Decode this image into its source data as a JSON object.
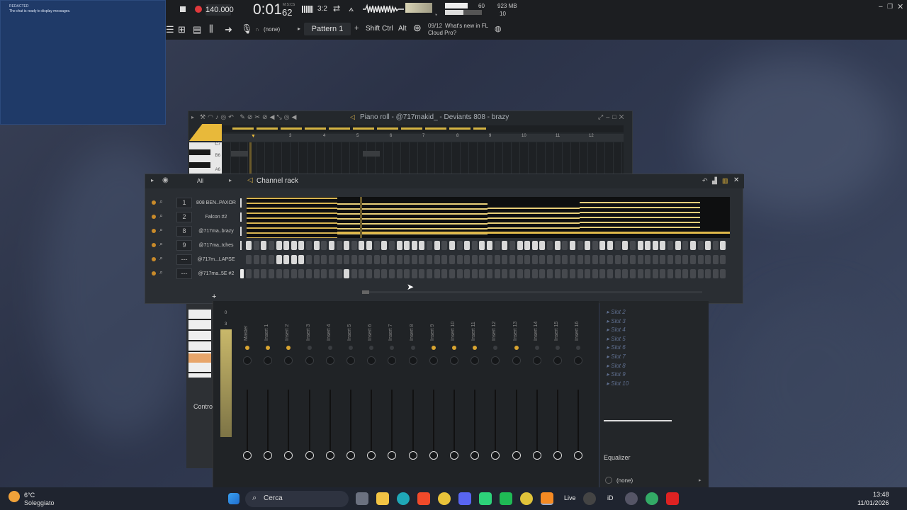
{
  "chat": {
    "title": "REDACTED",
    "message": "The chat is ready to display messages."
  },
  "toolbar": {
    "tempo": "140.000",
    "time": "0:01",
    "time_small": "62",
    "time_mode": "M:S:CS",
    "time_sig": "3:2",
    "cpu": "60",
    "memory": "923 MB",
    "voices": "10",
    "pattern": "Pattern 1",
    "mic_input": "(none)",
    "shift": "Shift",
    "ctrl": "Ctrl",
    "alt": "Alt",
    "news_date": "09/12",
    "news_text": "What's new in FL",
    "news_text2": "Cloud Pro?"
  },
  "piano_roll": {
    "title": "Piano roll - @717makid_ - Deviants 808 - brazy",
    "bars": [
      "3",
      "4",
      "5",
      "6",
      "7",
      "8",
      "9",
      "10",
      "11",
      "12"
    ],
    "key_labels": [
      "C7",
      "B6",
      "A6"
    ]
  },
  "channel_rack": {
    "title": "Channel rack",
    "filter": "All",
    "channels": [
      {
        "num": "1",
        "name": "808 BEN..PAXOR"
      },
      {
        "num": "2",
        "name": "Falcon #2"
      },
      {
        "num": "8",
        "name": "@717ma..brazy"
      },
      {
        "num": "9",
        "name": "@717ma..tches"
      },
      {
        "num": "---",
        "name": "@717m...LAPSE"
      },
      {
        "num": "---",
        "name": "@717ma..5E #2"
      }
    ]
  },
  "mixer": {
    "strips": [
      "Master",
      "Insert 1",
      "Insert 2",
      "Insert 3",
      "Insert 4",
      "Insert 5",
      "Insert 6",
      "Insert 7",
      "Insert 8",
      "Insert 9",
      "Insert 10",
      "Insert 11",
      "Insert 12",
      "Insert 13",
      "Insert 14",
      "Insert 15",
      "Insert 16"
    ],
    "left_labels": [
      "0",
      "3"
    ],
    "control_label": "Contro",
    "slots": [
      "Slot 2",
      "Slot 3",
      "Slot 4",
      "Slot 5",
      "Slot 6",
      "Slot 7",
      "Slot 8",
      "Slot 9",
      "Slot 10"
    ],
    "eq_label": "Equalizer",
    "output": "(none)"
  },
  "taskbar": {
    "temp": "6°C",
    "weather": "Soleggiato",
    "search": "Cerca",
    "time": "13:48",
    "date": "11/01/2026",
    "live": "Live",
    "id": "iD"
  }
}
